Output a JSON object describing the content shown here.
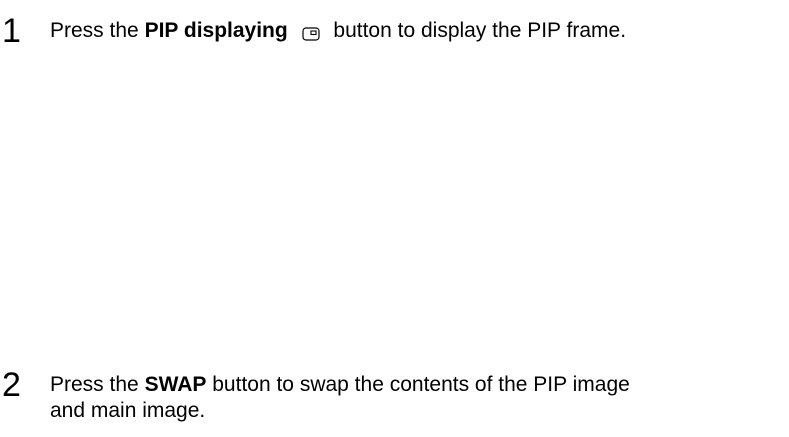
{
  "steps": [
    {
      "number": "1",
      "prefix": "Press the",
      "bold": "PIP displaying",
      "icon": "pip-icon",
      "suffix": "button to display the PIP frame."
    },
    {
      "number": "2",
      "prefix": "Press the",
      "bold": "SWAP",
      "line1_suffix": "button to swap the contents of the PIP image",
      "line2": "and main image."
    }
  ]
}
